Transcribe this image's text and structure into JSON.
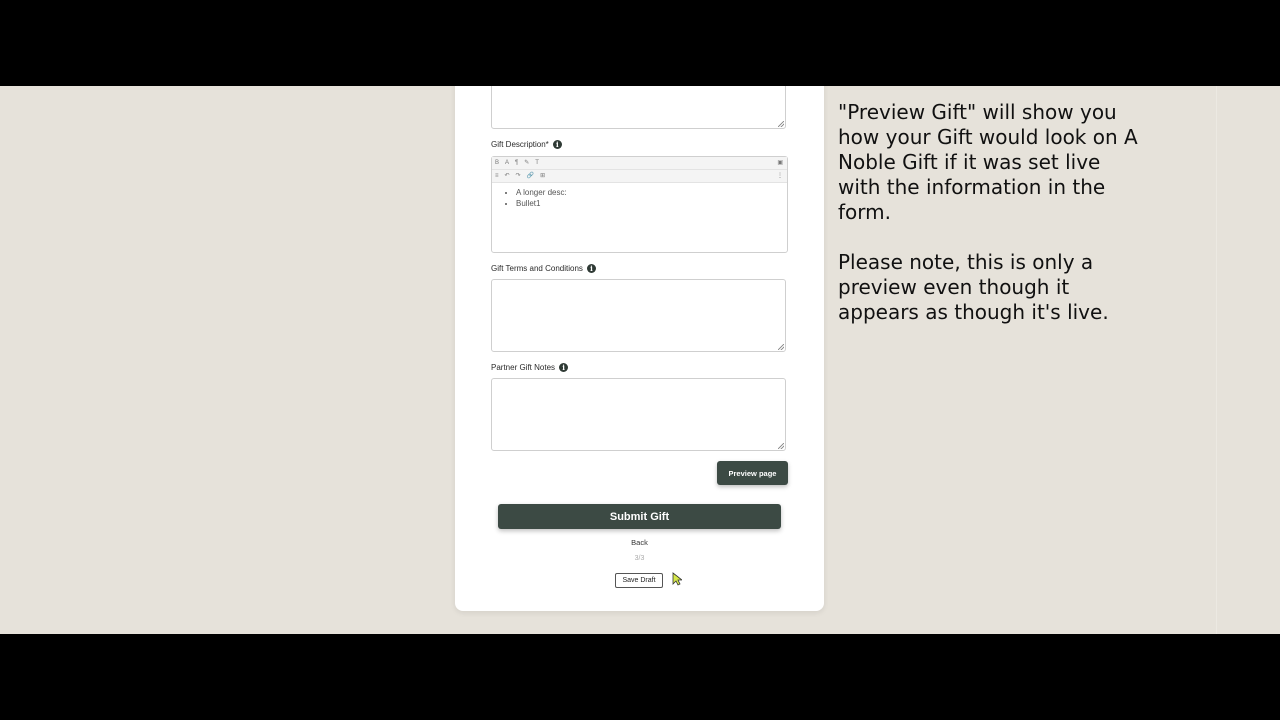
{
  "form": {
    "gift_description": {
      "label": "Gift Description*",
      "bullets": [
        "A longer desc:",
        "Bullet1"
      ]
    },
    "editor_toolbar": {
      "row1": [
        "B",
        "A",
        "¶",
        "✎",
        "T"
      ],
      "row2": [
        "≡",
        "↶",
        "↷",
        "🔗",
        "⊞"
      ]
    },
    "terms": {
      "label": "Gift Terms and Conditions"
    },
    "partner_notes": {
      "label": "Partner Gift Notes"
    },
    "preview_label": "Preview page",
    "submit_label": "Submit Gift",
    "back_label": "Back",
    "step_indicator": "3/3",
    "save_draft_label": "Save Draft"
  },
  "annotation": {
    "paragraph1": "\"Preview Gift\" will show you how your Gift would look on A Noble Gift if it was set live with the information in the form.",
    "paragraph2": "Please note, this is only a preview even though it appears as though it's live."
  },
  "colors": {
    "primary_button": "#3c4a44",
    "page_background": "#e6e2da",
    "letterbox": "#000000"
  }
}
